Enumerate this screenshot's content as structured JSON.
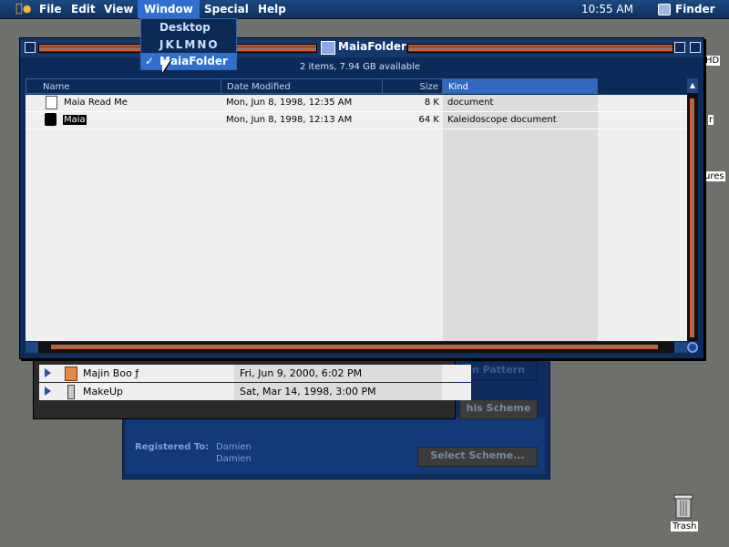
{
  "menubar": {
    "apple": "",
    "items": [
      "File",
      "Edit",
      "View",
      "Window",
      "Special",
      "Help"
    ],
    "clock": "10:55 AM",
    "app": "Finder"
  },
  "window_menu": {
    "options": [
      "Desktop",
      "JKLMNO",
      "MaiaFolder"
    ],
    "checked": "✓"
  },
  "main_window": {
    "title": "MaiaFolder",
    "info": "2 items, 7.94 GB available",
    "columns": [
      "Name",
      "Date Modified",
      "Size",
      "Kind"
    ],
    "rows": [
      {
        "name": "Maia Read Me",
        "date": "Mon, Jun 8, 1998, 12:35 AM",
        "size": "8 K",
        "kind": "document"
      },
      {
        "name": "Maia",
        "date": "Mon, Jun 8, 1998, 12:13 AM",
        "size": "64 K",
        "kind": "Kaleidoscope document"
      }
    ]
  },
  "back_list": {
    "rows": [
      {
        "name": "Majin Boo ƒ",
        "date": "Fri, Jun 9, 2000, 6:02 PM"
      },
      {
        "name": "MakeUp",
        "date": "Sat, Mar 14, 1998, 3:00 PM"
      }
    ]
  },
  "scheme_window": {
    "pattern_button": "n Pattern",
    "scheme_button": "his Scheme",
    "registered_label": "Registered To:",
    "registered_name1": "Damien",
    "registered_name2": "Damien",
    "select_button": "Select Scheme..."
  },
  "desktop_peeks": [
    "HD",
    "r",
    "ures"
  ],
  "trash": "Trash",
  "colors": {
    "accent": "#2e6fcf",
    "window_bg": "#0d2b5a",
    "stripe": "#d55b2d"
  }
}
